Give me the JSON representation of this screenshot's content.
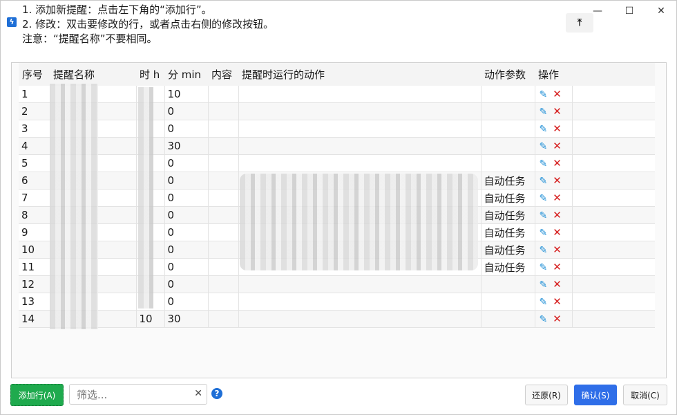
{
  "instructions": {
    "line1": "1. 添加新提醒：点击左下角的“添加行”。",
    "line2": "2. 修改：双击要修改的行，或者点击右侧的修改按钮。",
    "line3": "注意：“提醒名称”不要相同。"
  },
  "window_controls": {
    "minimize": "—",
    "maximize": "☐",
    "close": "✕"
  },
  "pin_label": "⤒",
  "table": {
    "headers": [
      "序号",
      "提醒名称",
      "时 h",
      "分 min",
      "内容",
      "提醒时运行的动作",
      "动作参数",
      "操作"
    ],
    "rows": [
      {
        "no": "1",
        "minute": "10",
        "param": ""
      },
      {
        "no": "2",
        "minute": "0",
        "param": ""
      },
      {
        "no": "3",
        "minute": "0",
        "param": ""
      },
      {
        "no": "4",
        "minute": "30",
        "param": ""
      },
      {
        "no": "5",
        "minute": "0",
        "param": ""
      },
      {
        "no": "6",
        "minute": "0",
        "param": "自动任务"
      },
      {
        "no": "7",
        "minute": "0",
        "param": "自动任务"
      },
      {
        "no": "8",
        "minute": "0",
        "param": "自动任务"
      },
      {
        "no": "9",
        "minute": "0",
        "param": "自动任务"
      },
      {
        "no": "10",
        "minute": "0",
        "param": "自动任务"
      },
      {
        "no": "11",
        "minute": "0",
        "param": "自动任务"
      },
      {
        "no": "12",
        "minute": "0",
        "param": ""
      },
      {
        "no": "13",
        "minute": "0",
        "param": ""
      },
      {
        "no": "14",
        "hour": "10",
        "minute": "30",
        "param": ""
      }
    ]
  },
  "bottom": {
    "add_row": "添加行(A)",
    "filter_placeholder": "筛选...",
    "clear": "✕",
    "help": "?",
    "restore": "还原(R)",
    "confirm": "确认(S)",
    "cancel": "取消(C)"
  }
}
